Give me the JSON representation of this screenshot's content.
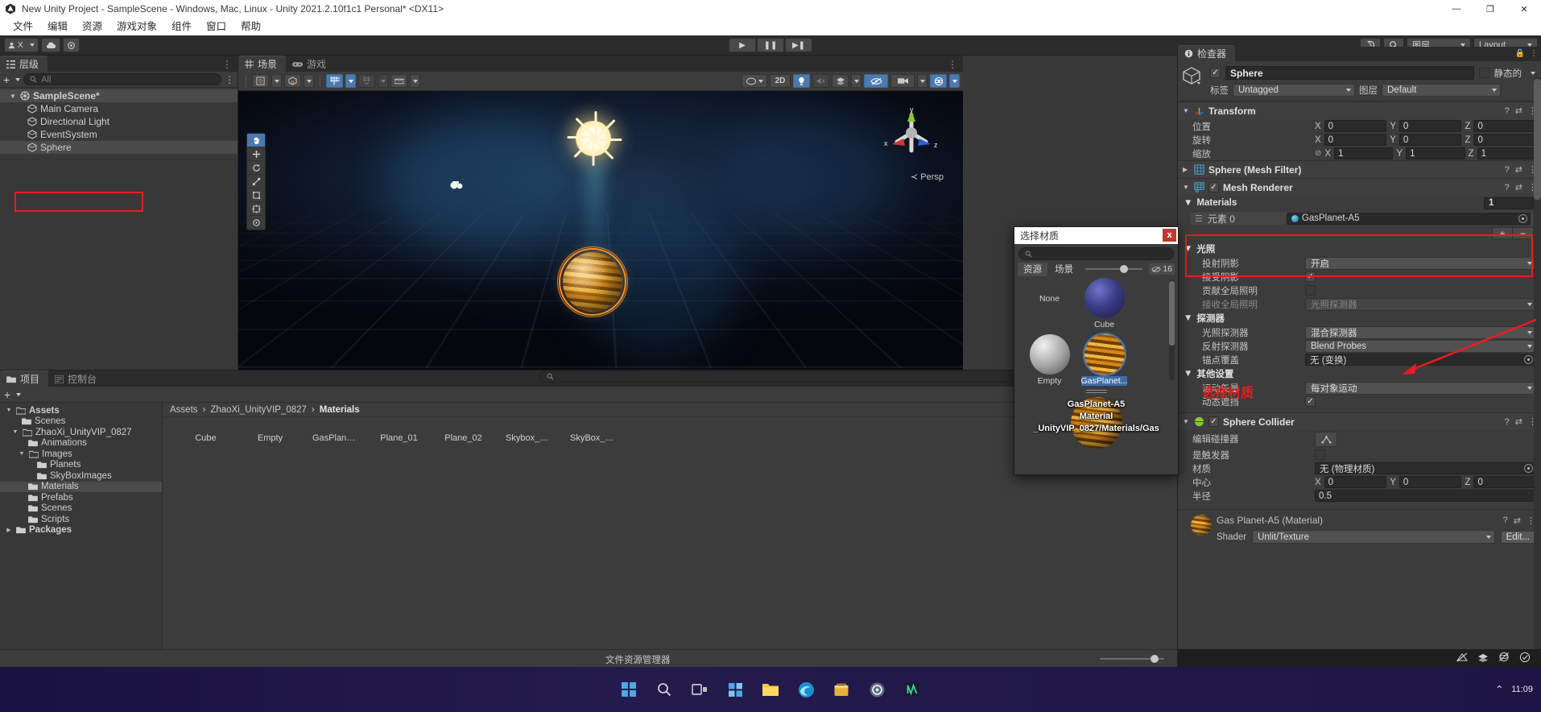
{
  "window": {
    "title": "New Unity Project - SampleScene - Windows, Mac, Linux - Unity 2021.2.10f1c1 Personal* <DX11>",
    "minimize": "—",
    "maximize": "❐",
    "close": "✕"
  },
  "menubar": {
    "items": [
      "文件",
      "编辑",
      "资源",
      "游戏对象",
      "组件",
      "窗口",
      "帮助"
    ]
  },
  "toolbar": {
    "account_label": "X",
    "cloud_icon": "cloud-icon",
    "settings_icon": "gear-icon",
    "play": "▶",
    "pause": "❚❚",
    "step": "▶❚",
    "history_icon": "history-icon",
    "search_icon": "search-icon",
    "layers_label": "图层",
    "layout_label": "Layout"
  },
  "hierarchy": {
    "tab": "层级",
    "add_label": "+",
    "search_placeholder": "All",
    "items": [
      {
        "label": "SampleScene*",
        "depth": 0,
        "icon": "scene-icon",
        "selected": false
      },
      {
        "label": "Main Camera",
        "depth": 1,
        "icon": "cube-icon",
        "selected": false
      },
      {
        "label": "Directional Light",
        "depth": 1,
        "icon": "cube-icon",
        "selected": false
      },
      {
        "label": "EventSystem",
        "depth": 1,
        "icon": "cube-icon",
        "selected": false
      },
      {
        "label": "Sphere",
        "depth": 1,
        "icon": "cube-icon",
        "selected": true
      }
    ]
  },
  "scene": {
    "tabs": [
      {
        "label": "场景",
        "active": true,
        "icon": "grid-icon"
      },
      {
        "label": "游戏",
        "active": false,
        "icon": "gamepad-icon"
      }
    ],
    "toolbar": {
      "pivot": "pivot-icon",
      "local": "local-icon",
      "grid": "grid-snap-icon",
      "magnet": "magnet-icon",
      "ruler": "ruler-icon",
      "shading": "shading-icon",
      "twod": "2D",
      "lighting": "light-bulb-icon",
      "audio": "audio-mute-icon",
      "fx": "fx-icon",
      "hidden": "hidden-icon",
      "camera": "camera-icon",
      "gizmos": "gizmos-icon"
    },
    "tools": [
      "hand-tool",
      "move-tool",
      "rotate-tool",
      "scale-tool",
      "rect-tool",
      "transform-tool",
      "custom-tool"
    ],
    "gizmo": {
      "x": "x",
      "y": "y",
      "z": "z",
      "persp": "≺ Persp"
    }
  },
  "inspector": {
    "tab": "检查器",
    "object": {
      "enabled": true,
      "name": "Sphere",
      "static_label": "静态的",
      "static_checked": false,
      "tag_label": "标签",
      "tag_value": "Untagged",
      "layer_label": "图层",
      "layer_value": "Default"
    },
    "transform": {
      "title": "Transform",
      "rows": [
        {
          "label": "位置",
          "x": "0",
          "y": "0",
          "z": "0"
        },
        {
          "label": "旋转",
          "x": "0",
          "y": "0",
          "z": "0"
        },
        {
          "label": "缩放",
          "x": "1",
          "y": "1",
          "z": "1"
        }
      ]
    },
    "mesh_filter": {
      "title": "Sphere (Mesh Filter)"
    },
    "mesh_renderer": {
      "title": "Mesh Renderer",
      "enabled": true,
      "materials": {
        "title": "Materials",
        "count": "1",
        "element_label": "元素 0",
        "element_value": "GasPlanet-A5",
        "add": "+",
        "remove": "−"
      },
      "lighting": {
        "title": "光照",
        "cast_shadows_label": "投射阴影",
        "cast_shadows_value": "开启",
        "receive_shadows_label": "接受阴影",
        "receive_shadows_checked": true,
        "contribute_gi_label": "贡献全局照明",
        "contribute_gi_checked": false,
        "receive_gi_label": "接收全局照明",
        "receive_gi_value": "光照探测器"
      },
      "probes": {
        "title": "探测器",
        "light_probes_label": "光照探测器",
        "light_probes_value": "混合探测器",
        "reflection_probes_label": "反射探测器",
        "reflection_probes_value": "Blend Probes",
        "anchor_override_label": "锚点覆盖",
        "anchor_override_value": "无 (变换)"
      },
      "other": {
        "title": "其他设置",
        "motion_vectors_label": "运动矢量",
        "motion_vectors_value": "每对象运动",
        "dynamic_occlusion_label": "动态遮挡",
        "dynamic_occlusion_checked": true
      }
    },
    "sphere_collider": {
      "title": "Sphere Collider",
      "enabled": true,
      "edit_collider_label": "编辑碰撞器",
      "is_trigger_label": "是触发器",
      "is_trigger_checked": false,
      "material_label": "材质",
      "material_value": "无 (物理材质)",
      "center_label": "中心",
      "center": {
        "x": "0",
        "y": "0",
        "z": "0"
      },
      "radius_label": "半径",
      "radius_value": "0.5"
    },
    "material_preview": {
      "title": "Gas Planet-A5 (Material)",
      "shader_label": "Shader",
      "shader_value": "Unlit/Texture",
      "edit_label": "Edit..."
    }
  },
  "material_dialog": {
    "title": "选择材质",
    "close": "x",
    "search_placeholder": "",
    "tabs": [
      {
        "label": "资源",
        "active": true
      },
      {
        "label": "场景",
        "active": false
      }
    ],
    "count": "16",
    "items": [
      {
        "label": "None",
        "kind": "none",
        "selected": false
      },
      {
        "label": "Cube",
        "kind": "cube",
        "selected": false
      },
      {
        "label": "Empty",
        "kind": "empty",
        "selected": false
      },
      {
        "label": "GasPlanet...",
        "kind": "gasplanet",
        "selected": true
      },
      {
        "label": "",
        "kind": "plane01",
        "selected": false
      },
      {
        "label": "",
        "kind": "plane02",
        "selected": false
      }
    ],
    "preview": {
      "line1": "GasPlanet-A5",
      "line2": "Material",
      "line3": "_UnityVIP_0827/Materials/Gas"
    }
  },
  "project": {
    "tabs": [
      {
        "label": "项目",
        "active": true,
        "icon": "folder-icon"
      },
      {
        "label": "控制台",
        "active": false,
        "icon": "console-icon"
      }
    ],
    "add_label": "+",
    "search_placeholder": "",
    "tree": [
      {
        "label": "Assets",
        "depth": 0,
        "expanded": true,
        "bold": true,
        "selected": false
      },
      {
        "label": "Scenes",
        "depth": 1,
        "expanded": null,
        "bold": false,
        "selected": false
      },
      {
        "label": "ZhaoXi_UnityVIP_0827",
        "depth": 1,
        "expanded": true,
        "bold": false,
        "selected": false
      },
      {
        "label": "Animations",
        "depth": 2,
        "expanded": null,
        "bold": false,
        "selected": false
      },
      {
        "label": "Images",
        "depth": 2,
        "expanded": true,
        "bold": false,
        "selected": false
      },
      {
        "label": "Planets",
        "depth": 3,
        "expanded": null,
        "bold": false,
        "selected": false
      },
      {
        "label": "SkyBoxImages",
        "depth": 3,
        "expanded": null,
        "bold": false,
        "selected": false
      },
      {
        "label": "Materials",
        "depth": 2,
        "expanded": null,
        "bold": false,
        "selected": true
      },
      {
        "label": "Prefabs",
        "depth": 2,
        "expanded": null,
        "bold": false,
        "selected": false
      },
      {
        "label": "Scenes",
        "depth": 2,
        "expanded": null,
        "bold": false,
        "selected": false
      },
      {
        "label": "Scripts",
        "depth": 2,
        "expanded": null,
        "bold": false,
        "selected": false
      },
      {
        "label": "Packages",
        "depth": 0,
        "expanded": false,
        "bold": true,
        "selected": false
      }
    ],
    "breadcrumb": [
      "Assets",
      "ZhaoXi_UnityVIP_0827",
      "Materials"
    ],
    "assets": [
      {
        "label": "Cube",
        "kind": "cube"
      },
      {
        "label": "Empty",
        "kind": "empty"
      },
      {
        "label": "GasPlanet...",
        "kind": "gasplanet"
      },
      {
        "label": "Plane_01",
        "kind": "plane01"
      },
      {
        "label": "Plane_02",
        "kind": "plane02"
      },
      {
        "label": "Skybox_Ca...",
        "kind": "skybox-ca"
      },
      {
        "label": "SkyBox_Co...",
        "kind": "skybox-co"
      }
    ],
    "status_label": "文件资源管理器"
  },
  "annotations": {
    "select_material_text": "选择材质"
  },
  "taskbar": {
    "icons": [
      "windows-start",
      "search-icon",
      "task-view",
      "widgets",
      "file-explorer",
      "edge-browser",
      "store",
      "settings-gear",
      "unity-hub"
    ],
    "tray": {
      "chevron": "⌃",
      "time": "11:09"
    }
  }
}
